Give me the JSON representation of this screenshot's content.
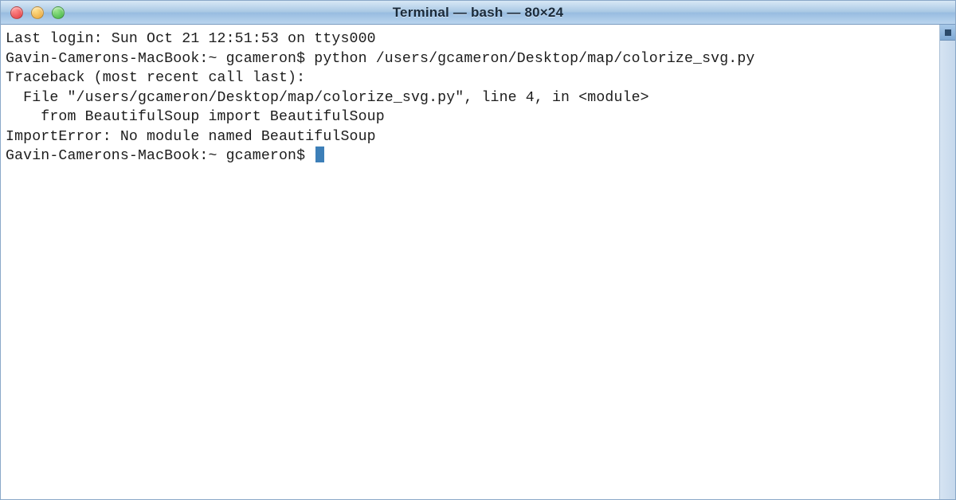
{
  "window": {
    "title": "Terminal — bash — 80×24"
  },
  "terminal": {
    "lines": [
      "Last login: Sun Oct 21 12:51:53 on ttys000",
      "Gavin-Camerons-MacBook:~ gcameron$ python /users/gcameron/Desktop/map/colorize_svg.py",
      "Traceback (most recent call last):",
      "  File \"/users/gcameron/Desktop/map/colorize_svg.py\", line 4, in <module>",
      "    from BeautifulSoup import BeautifulSoup",
      "ImportError: No module named BeautifulSoup"
    ],
    "prompt": "Gavin-Camerons-MacBook:~ gcameron$ "
  }
}
